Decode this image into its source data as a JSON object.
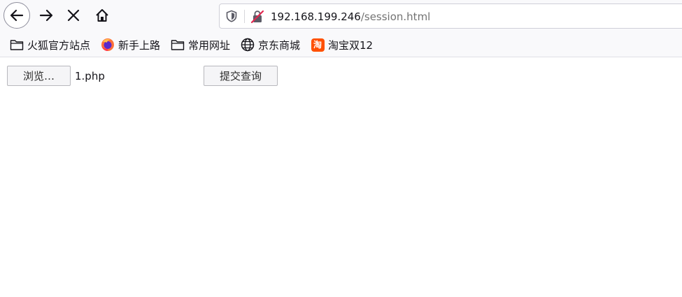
{
  "toolbar": {
    "back_icon": "arrow-left-icon",
    "forward_icon": "arrow-right-icon",
    "stop_icon": "close-icon",
    "home_icon": "home-icon"
  },
  "urlbar": {
    "shield_icon": "tracking-protection-shield-icon",
    "security_icon": "insecure-connection-icon",
    "host": "192.168.199.246",
    "path": "/session.html"
  },
  "bookmarks": [
    {
      "label": "火狐官方站点",
      "icon": "folder-icon"
    },
    {
      "label": "新手上路",
      "icon": "firefox-icon"
    },
    {
      "label": "常用网址",
      "icon": "folder-icon"
    },
    {
      "label": "京东商城",
      "icon": "globe-icon"
    },
    {
      "label": "淘宝双12",
      "icon": "taobao-icon",
      "icon_text": "淘"
    }
  ],
  "form": {
    "browse_label": "浏览…",
    "file_name": "1.php",
    "submit_label": "提交查询"
  },
  "colors": {
    "accent_insecure": "#e22850",
    "taobao": "#ff5000"
  }
}
